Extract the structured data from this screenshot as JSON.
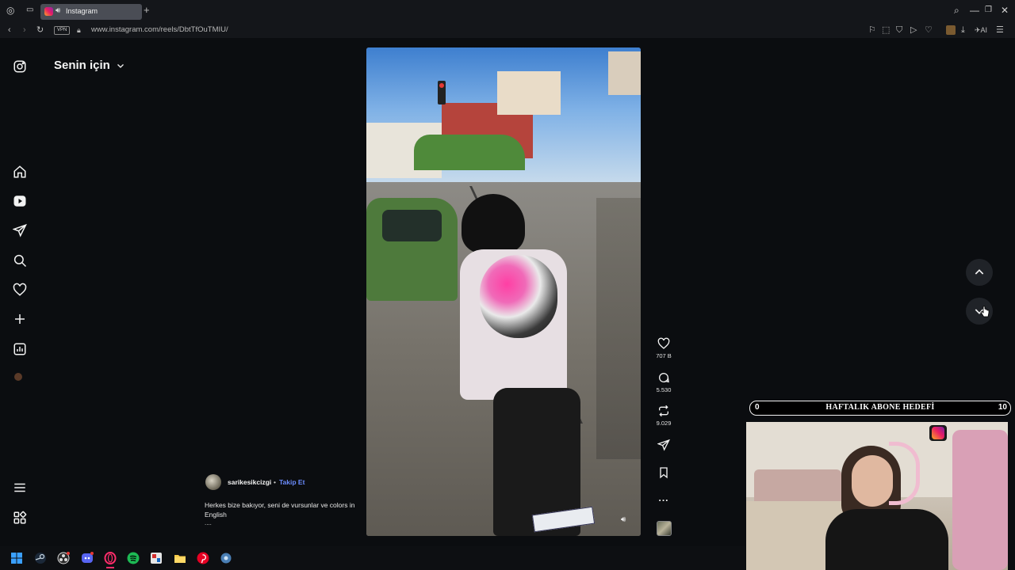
{
  "browser": {
    "tab_title": "Instagram",
    "tab_sound_icon": "speaker-icon",
    "new_tab_label": "+",
    "vpn_badge": "VPN",
    "url": "www.instagram.com/reels/DbtTfOuTMIU/"
  },
  "sidebar": {
    "items": [
      "instagram-logo-icon",
      "home-icon",
      "reels-icon",
      "send-icon",
      "search-icon",
      "heart-icon",
      "create-icon",
      "dashboard-icon",
      "profile-avatar",
      "menu-icon",
      "meta-apps-icon"
    ]
  },
  "feed": {
    "title": "Senin için"
  },
  "reel": {
    "actions": {
      "likes": "707 B",
      "comments": "5.530",
      "reposts": "9.029"
    },
    "caption": {
      "username": "sarikesikcizgi",
      "separator": "•",
      "follow_label": "Takip Et",
      "text": "Herkes bize bakıyor, seni de vursunlar ve colors in English",
      "more": "...."
    },
    "more_options": "..."
  },
  "overlay": {
    "goal_left": "0",
    "goal_title": "HAFTALIK ABONE HEDEFİ",
    "goal_right": "10"
  },
  "colors": {
    "follow_link": "#6b8cff",
    "page_background": "#0b0d10"
  }
}
